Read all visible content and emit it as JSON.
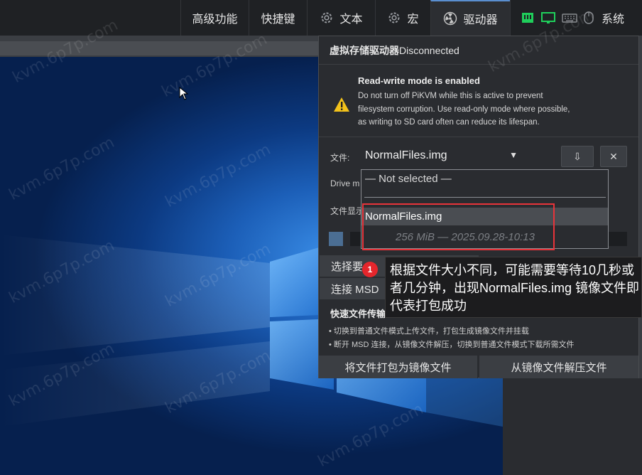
{
  "menu": {
    "items": [
      {
        "label": "高级功能",
        "icon": ""
      },
      {
        "label": "快捷键",
        "icon": ""
      },
      {
        "label": "文本",
        "icon": "gear-icon"
      },
      {
        "label": "宏",
        "icon": "gear-icon"
      },
      {
        "label": "驱动器",
        "icon": "radiation-icon"
      },
      {
        "label": "系统",
        "icon": "status-icons"
      }
    ],
    "active": "驱动器"
  },
  "panel": {
    "title_bold": "虚拟存储驱动器",
    "title_status": "Disconnected",
    "warning": {
      "title": "Read-write mode is enabled",
      "line1": "Do not turn off PiKVM while this is active to prevent",
      "line2": "filesystem corruption. Use read-only mode where possible,",
      "line3": "as writing to SD card often can reduce its lifespan."
    },
    "file_label": "文件:",
    "file_value": "NormalFiles.img",
    "download_icon": "⇩",
    "close_icon": "✕",
    "drive_label": "Drive m",
    "info_label": "文件显示",
    "select_btn": "选择要",
    "connect_btn": "连接 MSD",
    "quick_title": "快速文件传输",
    "quick_bullet1": "• 切换到普通文件模式上传文件，打包生成镜像文件并挂载",
    "quick_bullet2": "• 断开 MSD 连接，从镜像文件解压，切换到普通文件模式下载所需文件",
    "pack_btn": "将文件打包为镜像文件",
    "unpack_btn": "从镜像文件解压文件"
  },
  "dropdown": {
    "none_option": "— Not selected —",
    "selected_option": "NormalFiles.img",
    "selected_meta": "256 MiB — 2025.09.28-10:13"
  },
  "callout": {
    "badge": "1",
    "text": "根据文件大小不同，可能需要等待10几秒或者几分钟，出现NormalFiles.img 镜像文件即代表打包成功"
  },
  "watermark": "kvm.6p7p.com",
  "colors": {
    "accent": "#5a8fd0",
    "highlight_box": "#e8343a",
    "badge": "#e5262c",
    "warning": "#f2c21b"
  }
}
